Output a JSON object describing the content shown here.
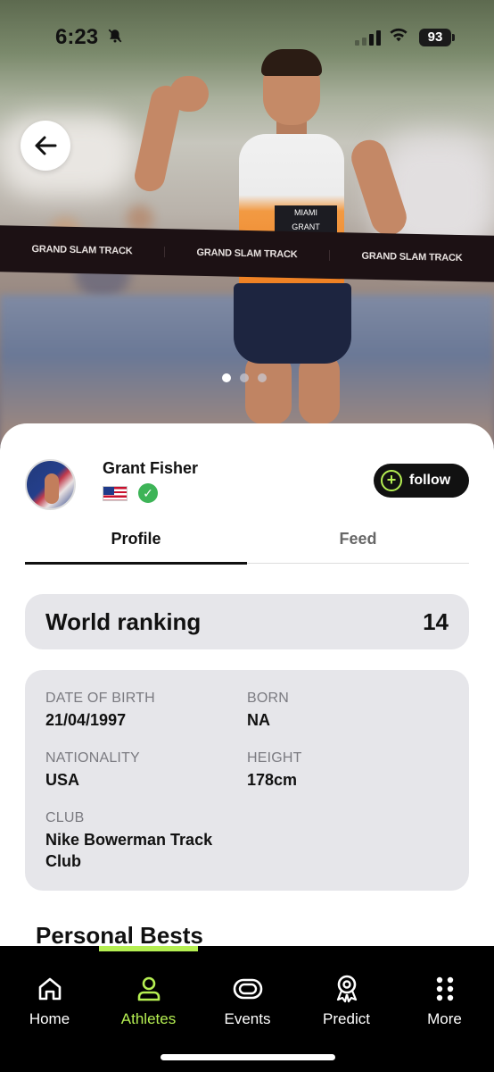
{
  "status_bar": {
    "time": "6:23",
    "battery": "93"
  },
  "hero": {
    "tape_texts": [
      "GRAND SLAM TRACK",
      "GRAND SLAM TRACK",
      "GRAND SLAM TRACK"
    ],
    "bib_top": "MIAMI",
    "bib_name": "GRANT",
    "carousel_pages": 3,
    "carousel_active": 0
  },
  "athlete": {
    "name": "Grant Fisher",
    "verified": true,
    "follow_label": "follow"
  },
  "tabs": [
    {
      "label": "Profile",
      "active": true
    },
    {
      "label": "Feed",
      "active": false
    }
  ],
  "ranking": {
    "label": "World ranking",
    "value": "14"
  },
  "details": {
    "dob_label": "DATE OF BIRTH",
    "dob_value": "21/04/1997",
    "born_label": "BORN",
    "born_value": "NA",
    "nationality_label": "NATIONALITY",
    "nationality_value": "USA",
    "height_label": "HEIGHT",
    "height_value": "178cm",
    "club_label": "CLUB",
    "club_value": "Nike Bowerman Track Club"
  },
  "personal_bests_title": "Personal Bests",
  "nav": [
    {
      "label": "Home",
      "icon": "home-icon",
      "active": false
    },
    {
      "label": "Athletes",
      "icon": "person-icon",
      "active": true
    },
    {
      "label": "Events",
      "icon": "track-oval-icon",
      "active": false
    },
    {
      "label": "Predict",
      "icon": "award-icon",
      "active": false
    },
    {
      "label": "More",
      "icon": "grid-dots-icon",
      "active": false
    }
  ],
  "colors": {
    "accent": "#b5ef52",
    "card_bg": "#e6e6ea",
    "verified": "#3db457"
  }
}
